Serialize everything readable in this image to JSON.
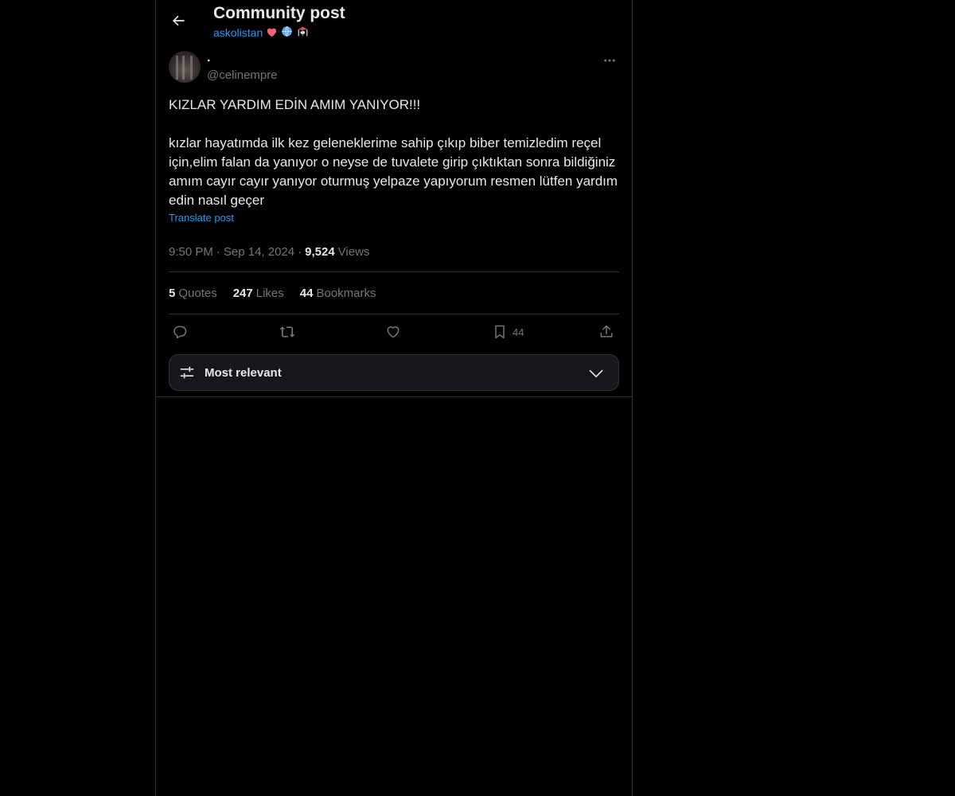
{
  "header": {
    "title": "Community post",
    "community_name": "askolistan",
    "community_emojis": [
      "heart-emoji",
      "globe-emoji",
      "carousel-emoji"
    ]
  },
  "post": {
    "display_name": ".",
    "handle": "@celinempre",
    "text_line_1": "KIZLAR YARDIM EDİN AMIM YANIYOR!!!",
    "text_body": "kızlar hayatımda ilk kez geleneklerime sahip çıkıp biber temizledim reçel için,elim falan da yanıyor o neyse de tuvalete girip çıktıktan sonra bildiğiniz amım cayır cayır yanıyor oturmuş yelpaze yapıyorum resmen lütfen yardım edin nasıl geçer",
    "translate_label": "Translate post",
    "time": "9:50 PM",
    "separator": "·",
    "date": "Sep 14, 2024",
    "views_count": "9,524",
    "views_label": "Views"
  },
  "stats": {
    "quotes_count": "5",
    "quotes_label": "Quotes",
    "likes_count": "247",
    "likes_label": "Likes",
    "bookmarks_count": "44",
    "bookmarks_label": "Bookmarks"
  },
  "actions": {
    "bookmark_count": "44",
    "icons": [
      "reply-icon",
      "repost-icon",
      "like-icon",
      "bookmark-icon",
      "share-icon"
    ]
  },
  "sort": {
    "label": "Most relevant"
  },
  "colors": {
    "background": "#000000",
    "text": "#e7e9ea",
    "muted": "#71767b",
    "accent": "#1d9bf0",
    "border": "#2f3336"
  }
}
